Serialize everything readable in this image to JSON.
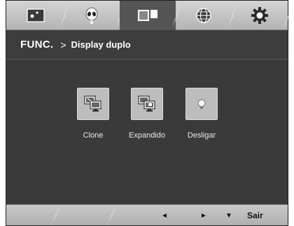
{
  "tabs": [
    {
      "icon": "picture-icon"
    },
    {
      "icon": "alien-icon"
    },
    {
      "icon": "dual-display-icon",
      "active": true
    },
    {
      "icon": "globe-icon"
    },
    {
      "icon": "gear-icon"
    }
  ],
  "title": {
    "func": "FUNC.",
    "separator": ">",
    "page": "Display duplo"
  },
  "options": [
    {
      "label": "Clone",
      "icon": "clone-monitors-icon"
    },
    {
      "label": "Expandido",
      "icon": "extended-monitors-icon"
    },
    {
      "label": "Desligar",
      "icon": "power-off-dot-icon"
    }
  ],
  "bottom": {
    "left": "◄",
    "right": "►",
    "down": "▼",
    "exit": "Sair"
  },
  "colors": {
    "tab_active": "#555555",
    "content_bg": "#3a3a3a",
    "bar_light": "#c9c9c9"
  }
}
